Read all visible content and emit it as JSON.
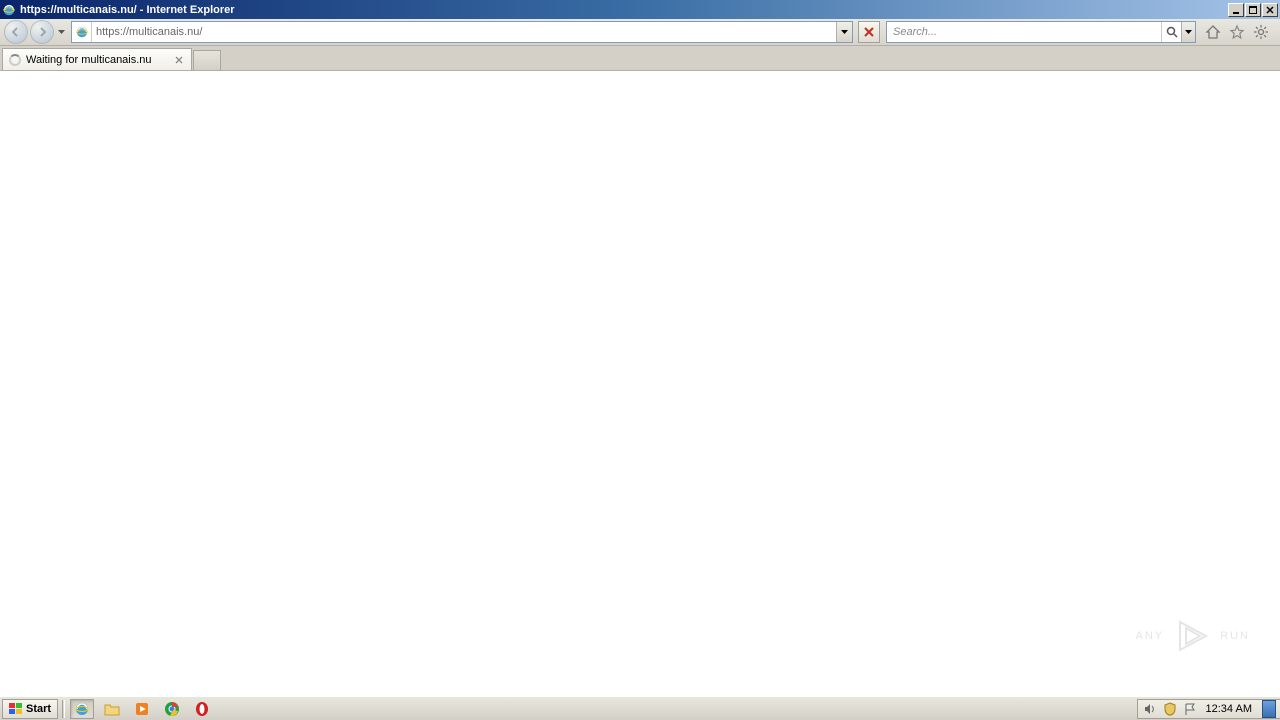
{
  "window": {
    "title": "https://multicanais.nu/ - Internet Explorer"
  },
  "nav": {
    "url": "https://multicanais.nu/",
    "search_placeholder": "Search..."
  },
  "tabs": [
    {
      "label": "Waiting for multicanais.nu",
      "loading": true
    }
  ],
  "watermark": {
    "left": "ANY",
    "right": "RUN"
  },
  "taskbar": {
    "start_label": "Start",
    "clock": "12:34 AM"
  }
}
